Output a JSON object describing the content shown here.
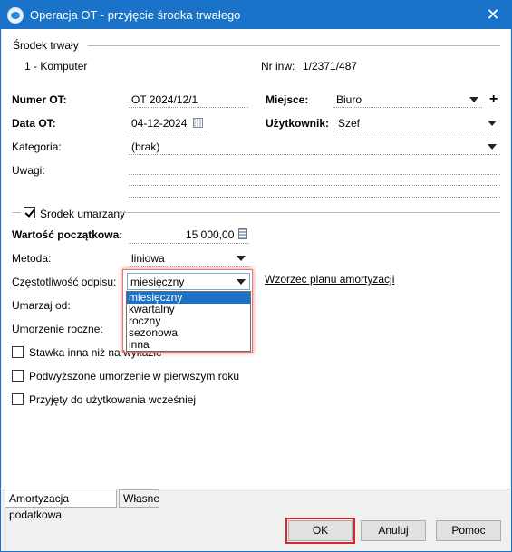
{
  "window": {
    "title": "Operacja OT - przyjęcie środka trwałego",
    "close_symbol": "✕",
    "icon": "app-logo-icon"
  },
  "srodek": {
    "section_label": "Środek trwały",
    "name": "1 - Komputer",
    "nr_inw_label": "Nr inw:",
    "nr_inw_value": "1/2371/487"
  },
  "form": {
    "numer_ot_label": "Numer OT:",
    "numer_ot_value": "OT 2024/12/1",
    "data_ot_label": "Data OT:",
    "data_ot_value": "04-12-2024",
    "miejsce_label": "Miejsce:",
    "miejsce_value": "Biuro",
    "uzytkownik_label": "Użytkownik:",
    "uzytkownik_value": "Szef",
    "kategoria_label": "Kategoria:",
    "kategoria_value": "(brak)",
    "uwagi_label": "Uwagi:",
    "plus_symbol": "+"
  },
  "amort": {
    "srodek_umarzany_label": "Środek umarzany",
    "srodek_umarzany_checked": true,
    "wartosc_label": "Wartość początkowa:",
    "wartosc_value": "15 000,00",
    "metoda_label": "Metoda:",
    "metoda_value": "liniowa",
    "czestotliwosc_label": "Częstotliwość odpisu:",
    "czestotliwosc_value": "miesięczny",
    "wzorzec_link": "Wzorzec planu amortyzacji",
    "umarzaj_label": "Umarzaj od:",
    "umorzenie_label": "Umorzenie roczne:",
    "dropdown_options": [
      "miesięczny",
      "kwartalny",
      "roczny",
      "sezonowa",
      "inna"
    ],
    "dropdown_selected_index": 0,
    "checkboxes": [
      {
        "label": "Stawka inna niż na wykazie",
        "checked": false
      },
      {
        "label": "Podwyższone umorzenie w pierwszym roku",
        "checked": false
      },
      {
        "label": "Przyjęty do użytkowania wcześniej",
        "checked": false
      }
    ]
  },
  "tabs": [
    {
      "label": "Amortyzacja podatkowa",
      "active": true
    },
    {
      "label": "Własne",
      "active": false
    }
  ],
  "buttons": {
    "ok": "OK",
    "anuluj": "Anuluj",
    "pomoc": "Pomoc"
  },
  "colors": {
    "titlebar": "#1a73c8",
    "selection": "#1a73c8",
    "highlight_red": "#d9262c"
  }
}
